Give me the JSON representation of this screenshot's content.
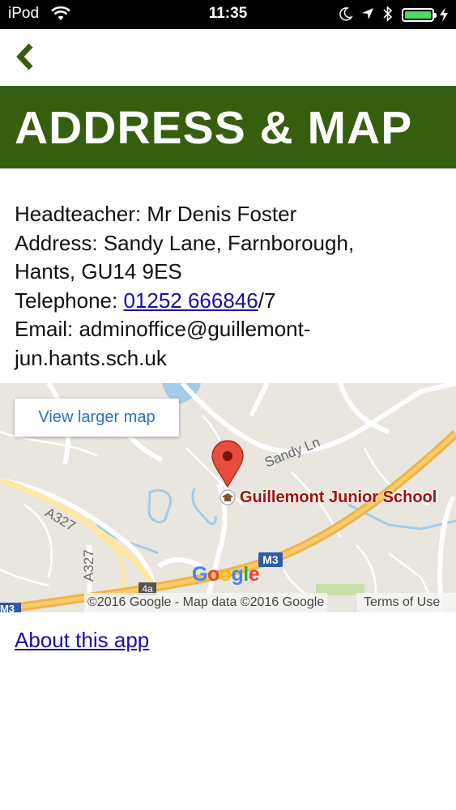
{
  "status_bar": {
    "carrier": "iPod",
    "time": "11:35",
    "icons": [
      "wifi-icon",
      "moon-icon",
      "location-arrow-icon",
      "bluetooth-icon",
      "battery-icon",
      "charging-bolt-icon"
    ]
  },
  "nav": {
    "back_icon": "chevron-left-icon"
  },
  "header": {
    "title": "ADDRESS & MAP",
    "band_color": "#365e0f"
  },
  "info": {
    "headteacher": "Headteacher: Mr Denis Foster",
    "address_line1": "Address: Sandy Lane, Farnborough,",
    "address_line2": "Hants, GU14 9ES",
    "telephone_label": "Telephone: ",
    "telephone_number": "01252 666846",
    "telephone_suffix": "/7",
    "email_line1": "Email: adminoffice@guillemont-",
    "email_line2": "jun.hants.sch.uk"
  },
  "map": {
    "view_larger": "View larger map",
    "street_sandy": "Sandy Ln",
    "street_a327_diag": "A327",
    "street_a327_vert": "A327",
    "place_name": "Guillemont Junior School",
    "road_m3": "M3",
    "road_m3_left": "M3",
    "junction": "4a",
    "google_logo": [
      "G",
      "o",
      "o",
      "g",
      "l",
      "e"
    ],
    "google_colors": [
      "#4285f4",
      "#ea4335",
      "#fbbc05",
      "#4285f4",
      "#34a853",
      "#ea4335"
    ],
    "attribution": "©2016 Google - Map data ©2016 Google",
    "terms": "Terms of Use",
    "marker_icon": "map-pin-icon",
    "school_icon": "school-icon"
  },
  "footer": {
    "about_link": "About this app"
  },
  "colors": {
    "link": "#1a0dab",
    "accent_green": "#365e0f",
    "marker_red": "#d93025"
  }
}
